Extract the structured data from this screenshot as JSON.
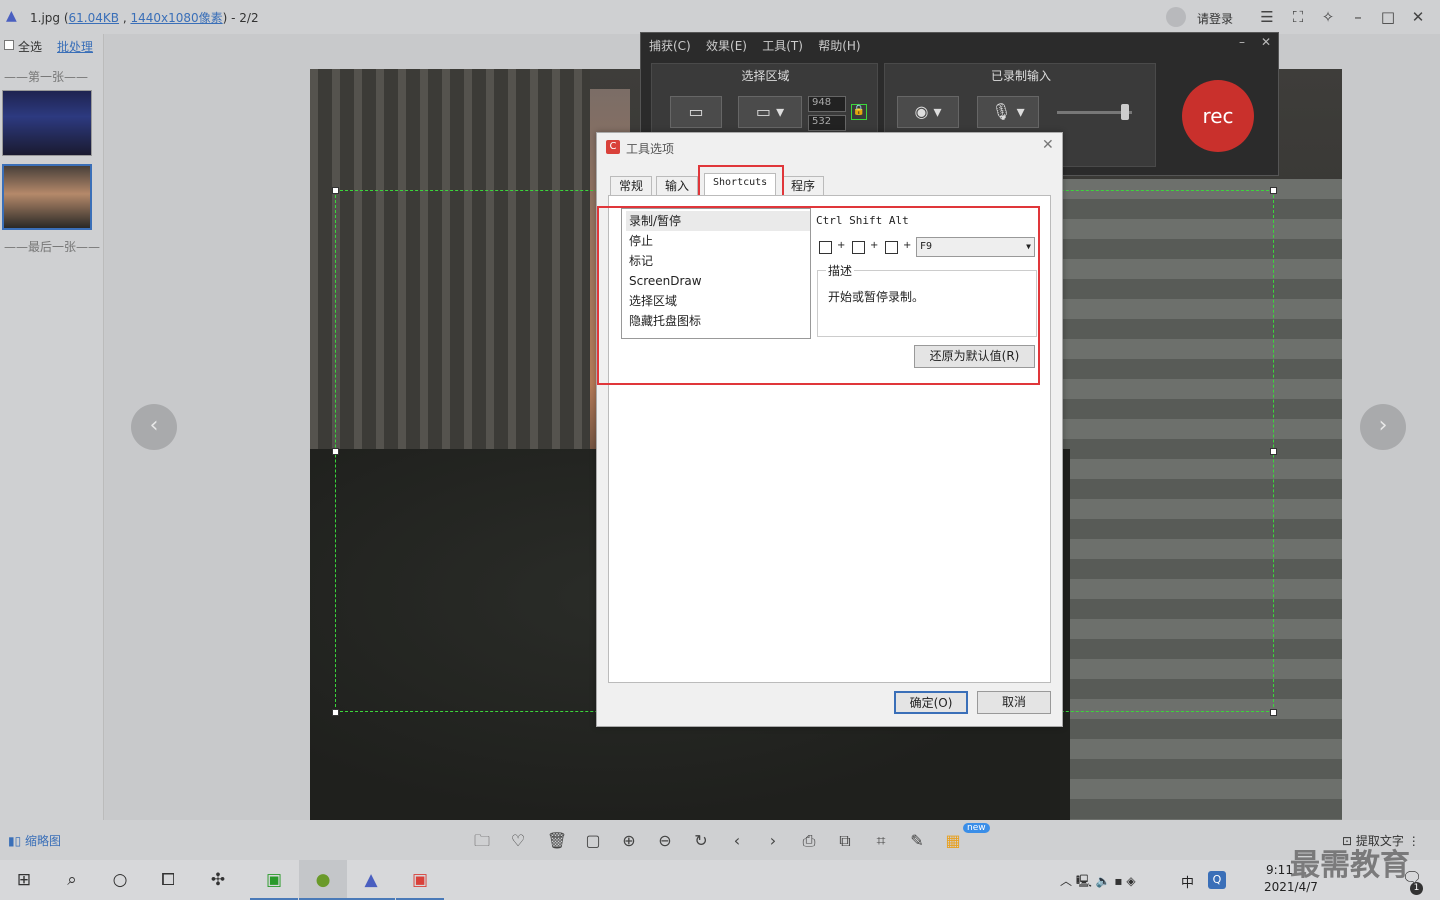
{
  "viewer": {
    "filename": "1.jpg",
    "size": "61.04KB",
    "dimensions": "1440x1080像素",
    "page": "2/2",
    "login": "请登录",
    "select_all": "全选",
    "batch": "批处理",
    "first": "第一张",
    "last": "最后一张",
    "thumbnail_label": "缩略图",
    "extract_text": "提取文字",
    "new_badge": "new"
  },
  "recorder": {
    "menu": [
      "捕获(C)",
      "效果(E)",
      "工具(T)",
      "帮助(H)"
    ],
    "select_area": "选择区域",
    "recorded_input": "已录制输入",
    "width": "948",
    "height": "532",
    "rec_label": "rec"
  },
  "dialog": {
    "title": "工具选项",
    "tabs": [
      "常规",
      "输入",
      "Shortcuts",
      "程序"
    ],
    "shortcut_items": [
      "录制/暂停",
      "停止",
      "标记",
      "ScreenDraw",
      "选择区域",
      "隐藏托盘图标"
    ],
    "modifiers_label": "Ctrl Shift Alt",
    "key": "F9",
    "desc_label": "描述",
    "desc_text": "开始或暂停录制。",
    "reset": "还原为默认值(R)",
    "ok": "确定(O)",
    "cancel": "取消"
  },
  "taskbar": {
    "ime": "中",
    "time": "9:11",
    "date": "2021/4/7",
    "badge": "1"
  },
  "watermark": "最需教育",
  "colors": {
    "highlight_red": "#e0363a",
    "rec_red": "#c9302c",
    "selection_green": "#3bd63b"
  }
}
